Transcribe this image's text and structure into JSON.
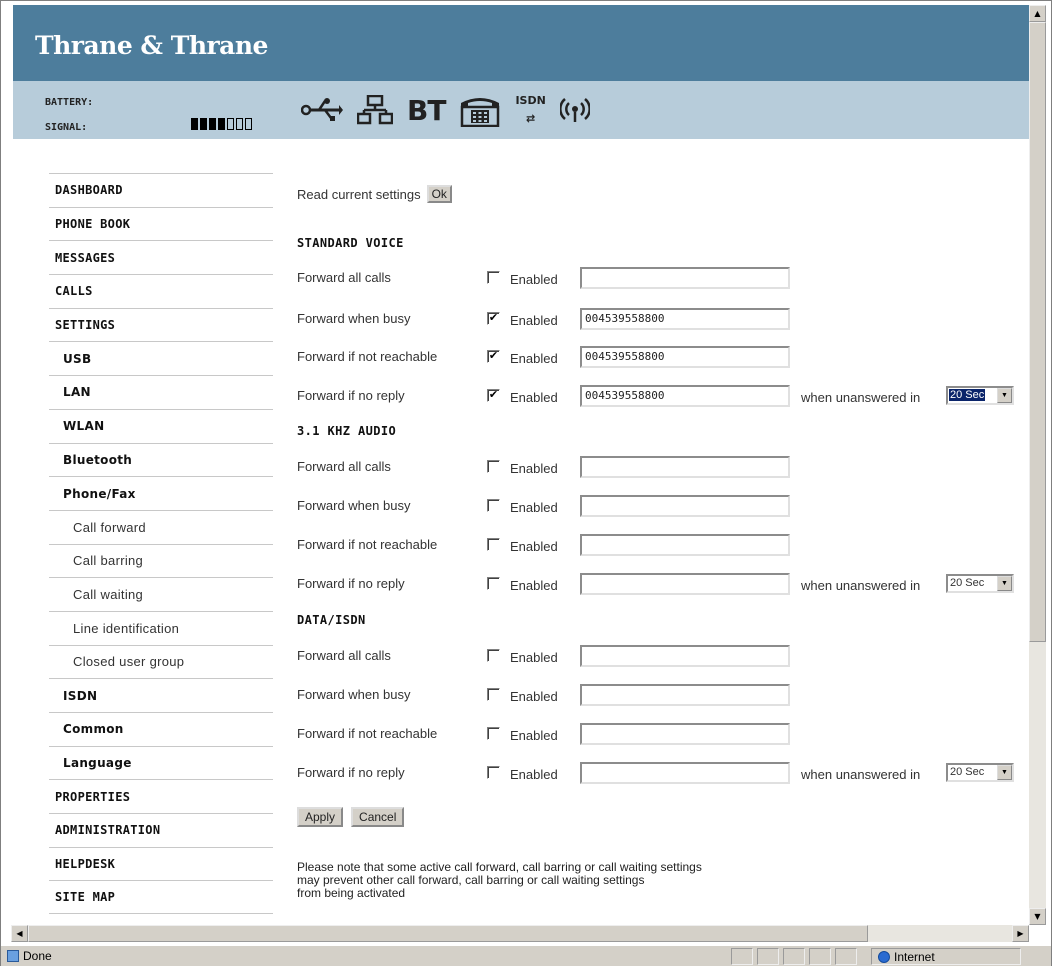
{
  "brand": {
    "title": "Thrane & Thrane"
  },
  "status": {
    "battery_label": "BATTERY:",
    "signal_label": "SIGNAL:",
    "signal_level": {
      "filled": 4,
      "total": 7
    },
    "icons": [
      {
        "name": "usb-icon",
        "glyph": "⭠"
      },
      {
        "name": "lan-icon",
        "glyph": "品"
      },
      {
        "name": "bluetooth-icon",
        "text": "BT"
      },
      {
        "name": "phone-fax-icon",
        "glyph": "☎"
      },
      {
        "name": "isdn-icon",
        "text": "ISDN",
        "glyph": "⇄"
      },
      {
        "name": "wireless-icon",
        "glyph": "((•))"
      }
    ]
  },
  "sidebar": {
    "items": [
      {
        "label": "DASHBOARD",
        "level": 0
      },
      {
        "label": "PHONE BOOK",
        "level": 0
      },
      {
        "label": "MESSAGES",
        "level": 0
      },
      {
        "label": "CALLS",
        "level": 0
      },
      {
        "label": "SETTINGS",
        "level": 0
      },
      {
        "label": "USB",
        "level": 1
      },
      {
        "label": "LAN",
        "level": 1
      },
      {
        "label": "WLAN",
        "level": 1
      },
      {
        "label": "Bluetooth",
        "level": 1
      },
      {
        "label": "Phone/Fax",
        "level": 1
      },
      {
        "label": "Call forward",
        "level": 2
      },
      {
        "label": "Call barring",
        "level": 2
      },
      {
        "label": "Call waiting",
        "level": 2
      },
      {
        "label": "Line identification",
        "level": 2
      },
      {
        "label": "Closed user group",
        "level": 2
      },
      {
        "label": "ISDN",
        "level": 1
      },
      {
        "label": "Common",
        "level": 1
      },
      {
        "label": "Language",
        "level": 1
      },
      {
        "label": "PROPERTIES",
        "level": 0
      },
      {
        "label": "ADMINISTRATION",
        "level": 0
      },
      {
        "label": "HELPDESK",
        "level": 0
      },
      {
        "label": "SITE MAP",
        "level": 0
      }
    ]
  },
  "main": {
    "read_label": "Read current settings",
    "ok_label": "Ok",
    "enabled_label": "Enabled",
    "when_label": "when unanswered in",
    "sections": [
      {
        "title": "STANDARD VOICE",
        "rows": [
          {
            "label": "Forward all calls",
            "checked": false,
            "value": ""
          },
          {
            "label": "Forward when busy",
            "checked": true,
            "value": "004539558800"
          },
          {
            "label": "Forward if not reachable",
            "checked": true,
            "value": "004539558800"
          },
          {
            "label": "Forward if no reply",
            "checked": true,
            "value": "004539558800",
            "delay": "20 Sec",
            "delay_highlighted": true
          }
        ]
      },
      {
        "title": "3.1 KHZ AUDIO",
        "rows": [
          {
            "label": "Forward all calls",
            "checked": false,
            "value": ""
          },
          {
            "label": "Forward when busy",
            "checked": false,
            "value": ""
          },
          {
            "label": "Forward if not reachable",
            "checked": false,
            "value": ""
          },
          {
            "label": "Forward if no reply",
            "checked": false,
            "value": "",
            "delay": "20 Sec",
            "delay_highlighted": false
          }
        ]
      },
      {
        "title": "DATA/ISDN",
        "rows": [
          {
            "label": "Forward all calls",
            "checked": false,
            "value": ""
          },
          {
            "label": "Forward when busy",
            "checked": false,
            "value": ""
          },
          {
            "label": "Forward if not reachable",
            "checked": false,
            "value": ""
          },
          {
            "label": "Forward if no reply",
            "checked": false,
            "value": "",
            "delay": "20 Sec",
            "delay_highlighted": false
          }
        ]
      }
    ],
    "apply_label": "Apply",
    "cancel_label": "Cancel",
    "note_lines": [
      "Please note that some active call forward, call barring or call waiting settings",
      "may prevent other call forward, call barring or call waiting settings",
      "from being activated"
    ]
  },
  "browser": {
    "status_text": "Done",
    "zone_text": "Internet"
  }
}
